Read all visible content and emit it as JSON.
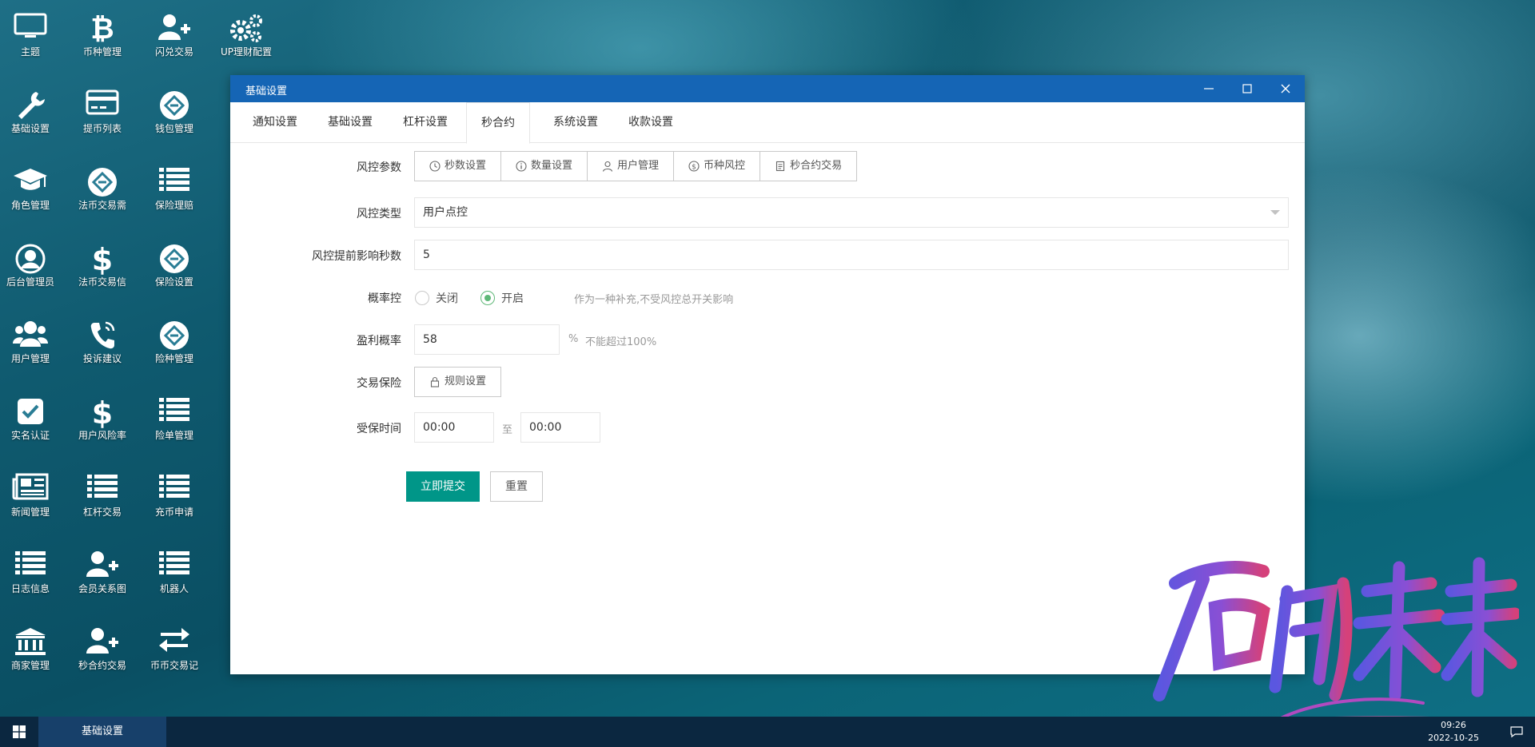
{
  "desktop": {
    "icons": [
      {
        "label": "主题",
        "icon": "monitor-icon"
      },
      {
        "label": "币种管理",
        "icon": "bitcoin-icon"
      },
      {
        "label": "闪兑交易",
        "icon": "user-plus-icon"
      },
      {
        "label": "UP理财配置",
        "icon": "gears-icon"
      },
      {
        "label": "基础设置",
        "icon": "wrench-icon"
      },
      {
        "label": "提币列表",
        "icon": "credit-card-icon"
      },
      {
        "label": "钱包管理",
        "icon": "diamond-link-icon"
      },
      {
        "label": "角色管理",
        "icon": "graduation-cap-icon"
      },
      {
        "label": "法币交易需",
        "icon": "diamond-link-icon"
      },
      {
        "label": "保险理赔",
        "icon": "list-icon"
      },
      {
        "label": "后台管理员",
        "icon": "user-circle-icon"
      },
      {
        "label": "法币交易信",
        "icon": "dollar-icon"
      },
      {
        "label": "保险设置",
        "icon": "diamond-link-icon"
      },
      {
        "label": "用户管理",
        "icon": "users-icon"
      },
      {
        "label": "投诉建议",
        "icon": "phone-icon"
      },
      {
        "label": "险种管理",
        "icon": "diamond-link-icon"
      },
      {
        "label": "实名认证",
        "icon": "check-square-icon"
      },
      {
        "label": "用户风险率",
        "icon": "dollar-icon"
      },
      {
        "label": "险单管理",
        "icon": "list-icon"
      },
      {
        "label": "新闻管理",
        "icon": "newspaper-icon"
      },
      {
        "label": "杠杆交易",
        "icon": "list-icon"
      },
      {
        "label": "充币申请",
        "icon": "list-icon"
      },
      {
        "label": "日志信息",
        "icon": "list-icon"
      },
      {
        "label": "会员关系图",
        "icon": "user-plus-icon"
      },
      {
        "label": "机器人",
        "icon": "list-icon"
      },
      {
        "label": "商家管理",
        "icon": "bank-icon"
      },
      {
        "label": "秒合约交易",
        "icon": "user-plus-icon"
      },
      {
        "label": "币币交易记",
        "icon": "exchange-icon"
      }
    ]
  },
  "window": {
    "title": "基础设置",
    "tabs": [
      "通知设置",
      "基础设置",
      "杠杆设置",
      "秒合约",
      "系统设置",
      "收款设置"
    ],
    "active_tab": "秒合约"
  },
  "form": {
    "risk_params_label": "风控参数",
    "risk_params_buttons": [
      {
        "label": "秒数设置",
        "icon": "clock-icon"
      },
      {
        "label": "数量设置",
        "icon": "info-icon"
      },
      {
        "label": "用户管理",
        "icon": "user-icon"
      },
      {
        "label": "币种风控",
        "icon": "dollar-circle-icon"
      },
      {
        "label": "秒合约交易",
        "icon": "document-icon"
      }
    ],
    "risk_type_label": "风控类型",
    "risk_type_value": "用户点控",
    "advance_seconds_label": "风控提前影响秒数",
    "advance_seconds_value": "5",
    "probability_label": "概率控",
    "probability_off": "关闭",
    "probability_on": "开启",
    "probability_selected": "开启",
    "probability_hint": "作为一种补充,不受风控总开关影响",
    "profit_rate_label": "盈利概率",
    "profit_rate_value": "58",
    "profit_rate_unit": "%",
    "profit_rate_hint": "不能超过100%",
    "insurance_label": "交易保险",
    "insurance_button": "规则设置",
    "insured_time_label": "受保时间",
    "insured_time_from": "00:00",
    "insured_time_sep": "至",
    "insured_time_to": "00:00",
    "submit_label": "立即提交",
    "reset_label": "重置"
  },
  "taskbar": {
    "active_task": "基础设置",
    "time": "09:26",
    "date": "2022-10-25"
  },
  "colors": {
    "titlebar": "#1565b5",
    "primary_button": "#009688",
    "radio_on": "#5fb878",
    "taskbar": "#0b2740"
  }
}
